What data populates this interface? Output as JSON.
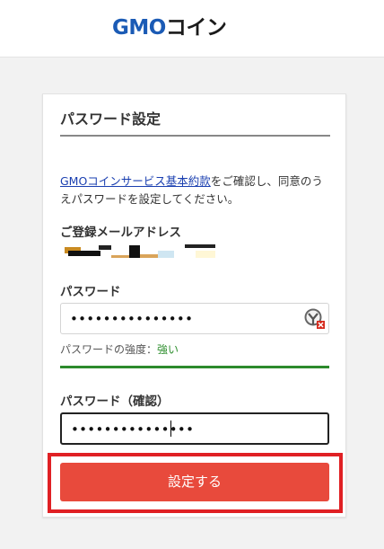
{
  "header": {
    "logo_gmo": "GMO",
    "logo_coin": "コイン"
  },
  "form": {
    "title": "パスワード設定",
    "terms_link": "GMOコインサービス基本約款",
    "terms_text": "をご確認し、同意のうえパスワードを設定してください。",
    "email_label": "ご登録メールアドレス",
    "password_label": "パスワード",
    "password_value": "•••••••••••••••",
    "strength_label": "パスワードの強度：",
    "strength_value": "強い",
    "confirm_label": "パスワード（確認）",
    "confirm_value": "•••••••••••••••",
    "submit_label": "設定する"
  },
  "colors": {
    "brand_blue": "#1b5bb5",
    "submit_red": "#e84a3c",
    "strength_green": "#2c8a2c",
    "highlight_red": "#e02024"
  },
  "icons": {
    "password_toggle": "eye-toggle-icon"
  }
}
